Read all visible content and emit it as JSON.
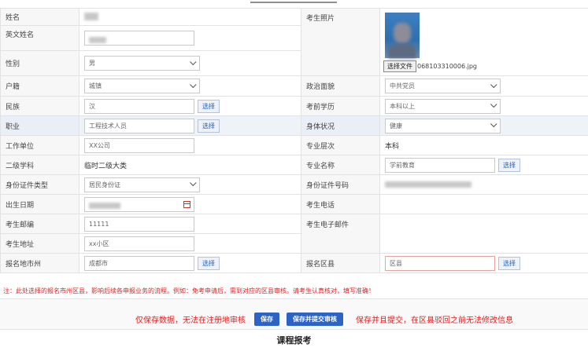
{
  "labels": {
    "name": "姓名",
    "english_name": "英文姓名",
    "gender": "性别",
    "household": "户籍",
    "ethnicity": "民族",
    "occupation": "职业",
    "work_unit": "工作单位",
    "second_subject": "二级学科",
    "id_type": "身份证件类型",
    "birth_date": "出生日期",
    "postal_code": "考生邮编",
    "address": "考生地址",
    "city": "报名地市州",
    "photo": "考生照片",
    "political_status": "政治面貌",
    "prior_education": "考前学历",
    "health": "身体状况",
    "major_level": "专业层次",
    "major_name": "专业名称",
    "id_number": "身份证件号码",
    "phone": "考生电话",
    "email": "考生电子邮件",
    "district": "报名区县"
  },
  "values": {
    "gender": "男",
    "household": "城镇",
    "ethnicity": "汉",
    "occupation": "工程技术人员",
    "work_unit": "XX公司",
    "second_subject": "临时二级大类",
    "id_type": "居民身份证",
    "postal_code": "11111",
    "address": "xx小区",
    "city": "成都市",
    "political_status": "中共党员",
    "prior_education": "本科以上",
    "health": "健康",
    "major_level": "本科",
    "major_name": "学前教育",
    "district_placeholder": "区县"
  },
  "photo": {
    "choose_file_label": "选择文件",
    "file_name": "068103310006.jpg"
  },
  "pick_label": "选择",
  "note": "注：此处选择的报名市州区县，影响后续各申报业务的流程。例如：免考申请后，需到对应的区县审核。请考生认真核对，填写准确！",
  "footer": {
    "text_left": "仅保存数据，无法在注册地审核",
    "save_button": "保存",
    "save_submit_button": "保存并提交审核",
    "text_right": "保存并且提交，在区县驳回之前无法修改信息"
  },
  "caption": "课程报考",
  "colors": {
    "accent": "#2c63c5",
    "warning": "#e02020"
  }
}
